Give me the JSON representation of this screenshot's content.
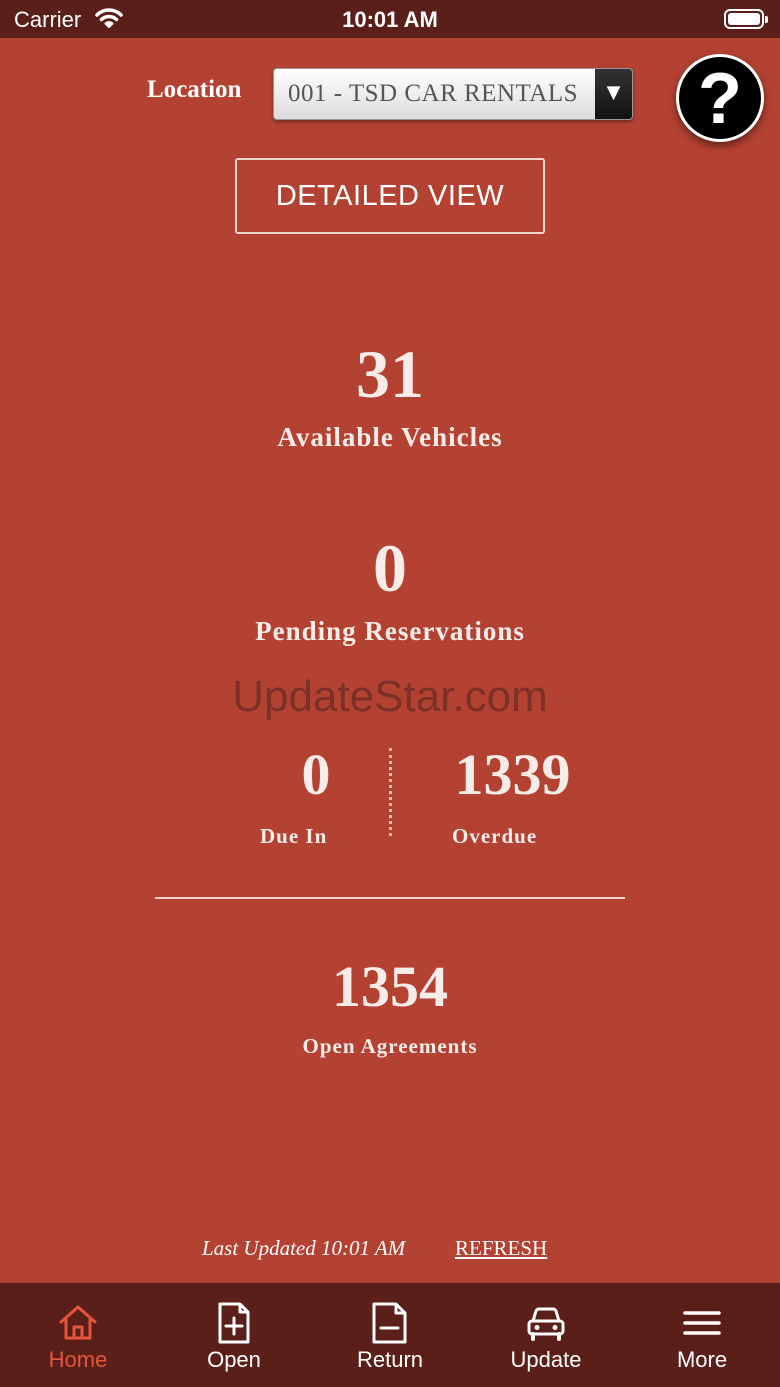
{
  "status_bar": {
    "carrier": "Carrier",
    "time": "10:01 AM",
    "icons": [
      "wifi-icon",
      "battery-icon"
    ]
  },
  "header": {
    "location_label": "Location",
    "location_value": "001 - TSD CAR RENTALS",
    "dropdown_arrow": "▼",
    "help_label": "?"
  },
  "detailed_view_label": "DETAILED VIEW",
  "stats": {
    "available_vehicles": {
      "value": "31",
      "label": "Available Vehicles"
    },
    "pending_reservations": {
      "value": "0",
      "label": "Pending Reservations"
    },
    "due_in": {
      "value": "0",
      "label": "Due In"
    },
    "overdue": {
      "value": "1339",
      "label": "Overdue"
    },
    "open_agreements": {
      "value": "1354",
      "label": "Open Agreements"
    }
  },
  "watermark": "UpdateStar.com",
  "footer": {
    "last_updated": "Last Updated 10:01 AM",
    "refresh": "REFRESH"
  },
  "tabs": [
    {
      "label": "Home",
      "icon": "home-icon",
      "active": true
    },
    {
      "label": "Open",
      "icon": "document-plus-icon",
      "active": false
    },
    {
      "label": "Return",
      "icon": "document-minus-icon",
      "active": false
    },
    {
      "label": "Update",
      "icon": "car-icon",
      "active": false
    },
    {
      "label": "More",
      "icon": "menu-icon",
      "active": false
    }
  ],
  "colors": {
    "background": "#b34232",
    "bars": "#5a1f19",
    "active_tab": "#e5543c"
  }
}
